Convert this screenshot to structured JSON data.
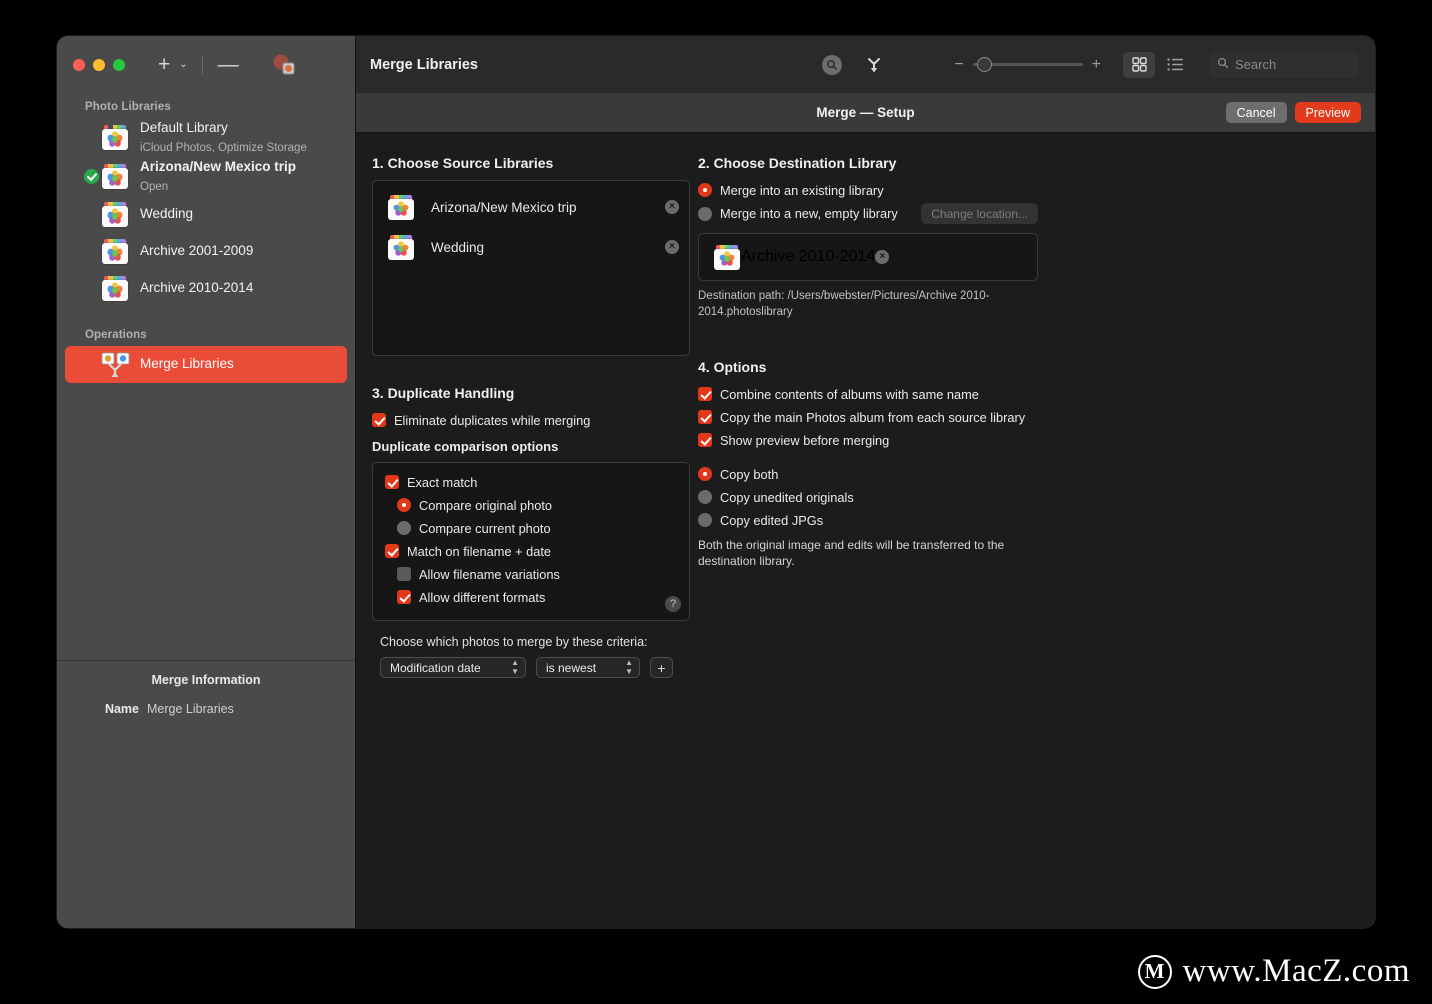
{
  "window": {
    "traffic_lights": [
      "close",
      "minimize",
      "zoom"
    ],
    "sidebar_toolbar": {
      "add_label": "+",
      "add_chevron": "⌄",
      "remove_label": "—",
      "merge_icon": "merge-libraries-icon"
    }
  },
  "sidebar": {
    "sections": [
      {
        "header": "Photo Libraries",
        "items": [
          {
            "title": "Default Library",
            "subtitle": "iCloud Photos, Optimize Storage",
            "checked": false,
            "bold": false
          },
          {
            "title": "Arizona/New Mexico trip",
            "subtitle": "Open",
            "checked": true,
            "bold": true
          },
          {
            "title": "Wedding",
            "subtitle": "",
            "checked": false,
            "bold": false
          },
          {
            "title": "Archive 2001-2009",
            "subtitle": "",
            "checked": false,
            "bold": false
          },
          {
            "title": "Archive 2010-2014",
            "subtitle": "",
            "checked": false,
            "bold": false
          }
        ]
      },
      {
        "header": "Operations",
        "items": [
          {
            "title": "Merge Libraries",
            "subtitle": "",
            "checked": false,
            "selected": true
          }
        ]
      }
    ],
    "info": {
      "title": "Merge Information",
      "rows": [
        {
          "label": "Name",
          "value": "Merge Libraries"
        }
      ]
    }
  },
  "main_toolbar": {
    "title": "Merge Libraries",
    "inspect_icon": "magnifier-circle-icon",
    "merge_icon": "merge-arrows-icon",
    "zoom_out": "−",
    "zoom_in": "+",
    "grid_view_icon": "grid-view-icon",
    "list_view_icon": "list-view-icon",
    "search_placeholder": "Search",
    "search_value": "",
    "search_icon": "search-icon"
  },
  "subbar": {
    "title": "Merge — Setup",
    "cancel_label": "Cancel",
    "preview_label": "Preview",
    "preview_color": "#e23b1b"
  },
  "section1": {
    "title": "1. Choose Source Libraries",
    "libraries": [
      {
        "name": "Arizona/New Mexico trip",
        "remove": "×"
      },
      {
        "name": "Wedding",
        "remove": "×"
      }
    ]
  },
  "section2": {
    "title": "2. Choose Destination Library",
    "radios": [
      {
        "label": "Merge into an existing library",
        "selected": true
      },
      {
        "label": "Merge into a new, empty library",
        "selected": false
      }
    ],
    "change_location_label": "Change location...",
    "destination": {
      "name": "Archive 2010-2014",
      "remove": "×"
    },
    "destination_path": "Destination path: /Users/bwebster/Pictures/Archive 2010-2014.photoslibrary"
  },
  "section3": {
    "title": "3. Duplicate Handling",
    "eliminate": {
      "label": "Eliminate duplicates while merging",
      "checked": true
    },
    "options_label": "Duplicate comparison options",
    "options": [
      {
        "type": "checkbox",
        "label": "Exact match",
        "checked": true,
        "indent": 0
      },
      {
        "type": "radio",
        "label": "Compare original photo",
        "selected": true,
        "indent": 1
      },
      {
        "type": "radio",
        "label": "Compare current photo",
        "selected": false,
        "indent": 1
      },
      {
        "type": "checkbox",
        "label": "Match on filename + date",
        "checked": true,
        "indent": 0
      },
      {
        "type": "checkbox",
        "label": "Allow filename variations",
        "checked": false,
        "indent": 1
      },
      {
        "type": "checkbox",
        "label": "Allow different formats",
        "checked": true,
        "indent": 1
      }
    ],
    "help_label": "?",
    "criteria_label": "Choose which photos to merge by these criteria:",
    "criteria_field": "Modification date",
    "criteria_comparator": "is newest",
    "add_criteria_label": "+"
  },
  "section4": {
    "title": "4. Options",
    "checkboxes": [
      {
        "label": "Combine contents of albums with same name",
        "checked": true
      },
      {
        "label": "Copy the main Photos album from each source library",
        "checked": true
      },
      {
        "label": "Show preview before merging",
        "checked": true
      }
    ],
    "radios": [
      {
        "label": "Copy both",
        "selected": true
      },
      {
        "label": "Copy unedited originals",
        "selected": false
      },
      {
        "label": "Copy edited JPGs",
        "selected": false
      }
    ],
    "note": "Both the original image and edits will be transferred to the destination library."
  },
  "watermark": {
    "logo": "M",
    "text": "www.MacZ.com"
  }
}
